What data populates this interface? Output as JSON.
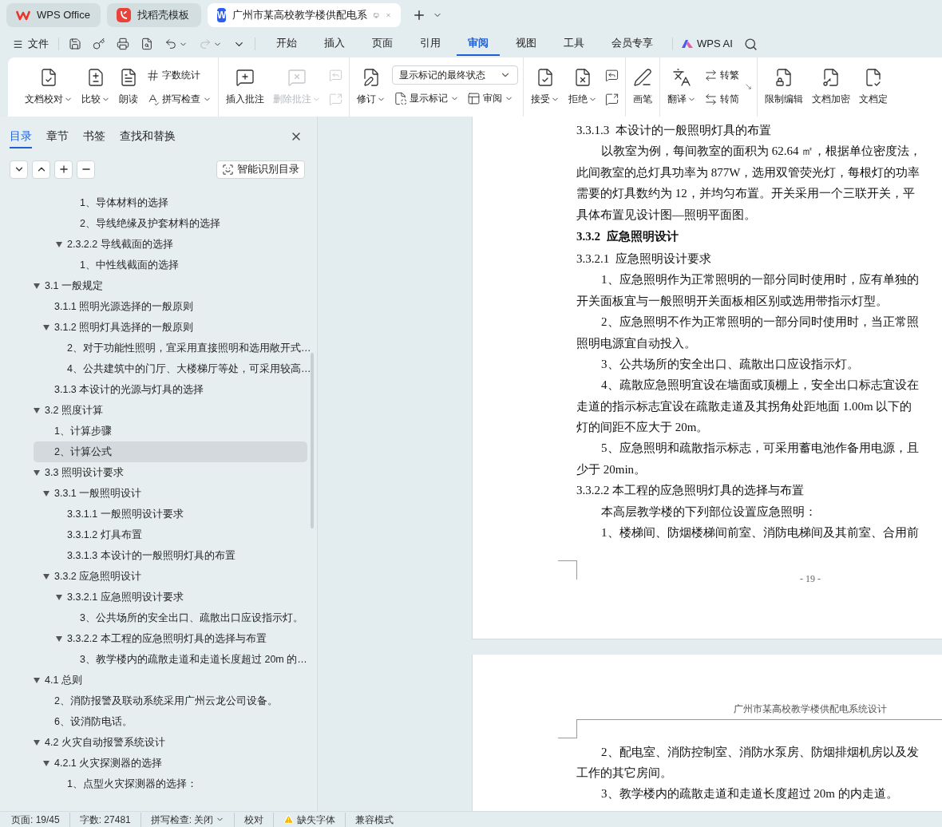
{
  "browser_tabs": [
    {
      "kind": "wps",
      "label": "WPS Office",
      "selected": false
    },
    {
      "kind": "template",
      "label": "找稻壳模板",
      "selected": false
    },
    {
      "kind": "doc",
      "logo_letter": "W",
      "label": "广州市某高校教学楼供配电系",
      "selected": true
    }
  ],
  "menu": {
    "file": "文件",
    "tabs": [
      {
        "label": "开始",
        "selected": false
      },
      {
        "label": "插入",
        "selected": false
      },
      {
        "label": "页面",
        "selected": false
      },
      {
        "label": "引用",
        "selected": false
      },
      {
        "label": "审阅",
        "selected": true
      },
      {
        "label": "视图",
        "selected": false
      },
      {
        "label": "工具",
        "selected": false
      },
      {
        "label": "会员专享",
        "selected": false
      }
    ],
    "ai": "WPS AI",
    "redo_disabled": true
  },
  "ribbon": {
    "groups": [
      {
        "items": [
          {
            "kind": "large",
            "label": "文档校对",
            "dropdown": true,
            "disabled": false
          },
          {
            "kind": "large",
            "label": "比较",
            "dropdown": true,
            "disabled": false
          },
          {
            "kind": "large",
            "label": "朗读",
            "dropdown": false,
            "disabled": false
          },
          {
            "kind": "stack",
            "items": [
              {
                "label": "字数统计",
                "dropdown": false,
                "disabled": false
              },
              {
                "label": "拼写检查",
                "dropdown": true,
                "disabled": false
              }
            ]
          }
        ]
      },
      {
        "items": [
          {
            "kind": "large",
            "label": "插入批注",
            "dropdown": false,
            "disabled": false
          },
          {
            "kind": "large",
            "label": "删除批注",
            "dropdown": true,
            "disabled": true
          },
          {
            "kind": "stack",
            "items": [
              {
                "dropdown": false,
                "disabled": true
              },
              {
                "dropdown": false,
                "disabled": true
              }
            ]
          }
        ]
      },
      {
        "items": [
          {
            "kind": "large",
            "label": "修订",
            "dropdown": true,
            "disabled": false
          },
          {
            "kind": "select",
            "value": "显示标记的最终状态",
            "items": [
              {
                "label": "显示标记",
                "dropdown": true,
                "disabled": false
              },
              {
                "label": "审阅",
                "dropdown": true,
                "disabled": false
              }
            ]
          }
        ]
      },
      {
        "items": [
          {
            "kind": "large",
            "label": "接受",
            "dropdown": true,
            "disabled": false
          },
          {
            "kind": "large",
            "label": "拒绝",
            "dropdown": true,
            "disabled": false
          },
          {
            "kind": "stack",
            "items": [
              {
                "dropdown": false,
                "disabled": false
              },
              {
                "dropdown": false,
                "disabled": false
              }
            ]
          }
        ]
      },
      {
        "items": [
          {
            "kind": "large",
            "label": "画笔",
            "dropdown": false,
            "disabled": false
          }
        ]
      },
      {
        "items": [
          {
            "kind": "large",
            "label": "翻译",
            "dropdown": true,
            "disabled": false
          },
          {
            "kind": "stack",
            "items": [
              {
                "label": "转繁",
                "dropdown": false,
                "disabled": false
              },
              {
                "label": "转简",
                "dropdown": false,
                "disabled": false
              }
            ]
          },
          {
            "kind": "launcher"
          }
        ]
      },
      {
        "items": [
          {
            "kind": "large",
            "label": "限制编辑",
            "dropdown": false,
            "disabled": false
          },
          {
            "kind": "large",
            "label": "文档加密",
            "dropdown": false,
            "disabled": false
          },
          {
            "kind": "large",
            "label": "文档定",
            "dropdown": false,
            "disabled": false
          }
        ]
      }
    ]
  },
  "sidebar": {
    "tabs": [
      {
        "label": "目录",
        "selected": true
      },
      {
        "label": "章节",
        "selected": false
      },
      {
        "label": "书签",
        "selected": false
      },
      {
        "label": "查找和替换",
        "selected": false
      }
    ],
    "smart_button": "智能识别目录",
    "toc": [
      {
        "kind": "offscreen",
        "children": [
          {
            "kind": "offscreen",
            "children": [
              {
                "kind": "offscreen",
                "children": [
                  {
                    "kind": "item",
                    "label": "1、导体材料的选择",
                    "selected": false
                  },
                  {
                    "kind": "item",
                    "label": "2、导线绝缘及护套材料的选择",
                    "selected": false
                  }
                ]
              },
              {
                "kind": "item",
                "label": "2.3.2.2 导线截面的选择",
                "selected": false,
                "expanded": true,
                "children": [
                  {
                    "kind": "item",
                    "label": "1、中性线截面的选择",
                    "selected": false
                  }
                ]
              }
            ]
          }
        ]
      },
      {
        "kind": "item",
        "label": "3.1  一般规定",
        "selected": false,
        "expanded": true,
        "children": [
          {
            "kind": "item",
            "label": "3.1.1  照明光源选择的一般原则",
            "selected": false
          },
          {
            "kind": "item",
            "label": "3.1.2  照明灯具选择的一般原则",
            "selected": false,
            "expanded": true,
            "children": [
              {
                "kind": "item",
                "label": "2、对于功能性照明，宜采用直接照明和选用敞开式…",
                "selected": false
              },
              {
                "kind": "item",
                "label": "4、公共建筑中的门厅、大楼梯厅等处，可采用较高…",
                "selected": false
              }
            ]
          },
          {
            "kind": "item",
            "label": "3.1.3  本设计的光源与灯具的选择",
            "selected": false
          }
        ]
      },
      {
        "kind": "item",
        "label": "3.2 照度计算",
        "selected": false,
        "expanded": true,
        "children": [
          {
            "kind": "item",
            "label": "1、计算步骤",
            "selected": false
          },
          {
            "kind": "item",
            "label": "2、计算公式",
            "selected": true
          }
        ]
      },
      {
        "kind": "item",
        "label": "3.3  照明设计要求",
        "selected": false,
        "expanded": true,
        "children": [
          {
            "kind": "item",
            "label": "3.3.1  一般照明设计",
            "selected": false,
            "expanded": true,
            "children": [
              {
                "kind": "item",
                "label": "3.3.1.1  一般照明设计要求",
                "selected": false
              },
              {
                "kind": "item",
                "label": "3.3.1.2  灯具布置",
                "selected": false
              },
              {
                "kind": "item",
                "label": "3.3.1.3  本设计的一般照明灯具的布置",
                "selected": false
              }
            ]
          },
          {
            "kind": "item",
            "label": "3.3.2  应急照明设计",
            "selected": false,
            "expanded": true,
            "children": [
              {
                "kind": "item",
                "label": "3.3.2.1  应急照明设计要求",
                "selected": false,
                "expanded": true,
                "children": [
                  {
                    "kind": "item",
                    "label": "3、公共场所的安全出口、疏散出口应设指示灯。",
                    "selected": false
                  }
                ]
              },
              {
                "kind": "item",
                "label": "3.3.2.2 本工程的应急照明灯具的选择与布置",
                "selected": false,
                "expanded": true,
                "children": [
                  {
                    "kind": "item",
                    "label": "3、教学楼内的疏散走道和走道长度超过 20m 的…",
                    "selected": false
                  }
                ]
              }
            ]
          }
        ]
      },
      {
        "kind": "item",
        "label": "4.1  总则",
        "selected": false,
        "expanded": true,
        "children": [
          {
            "kind": "item",
            "label": "2、消防报警及联动系统采用广州云龙公司设备。",
            "selected": false
          },
          {
            "kind": "item",
            "label": "6、设消防电话。",
            "selected": false
          }
        ]
      },
      {
        "kind": "item",
        "label": "4.2  火灾自动报警系统设计",
        "selected": false,
        "expanded": true,
        "children": [
          {
            "kind": "item",
            "label": "4.2.1  火灾探测器的选择",
            "selected": false,
            "expanded": true,
            "children": [
              {
                "kind": "item",
                "label": "1、点型火灾探测器的选择：",
                "selected": false
              }
            ]
          }
        ]
      }
    ]
  },
  "document": {
    "pages": [
      {
        "lines": [
          {
            "kind": "heading",
            "text": "3.3.1.3  本设计的一般照明灯具的布置"
          },
          {
            "kind": "indent",
            "text": "以教室为例，每间教室的面积为 62.64 ㎡，根据单位密度法，"
          },
          {
            "kind": "line",
            "text": "此间教室的总灯具功率为 877W，选用双管荧光灯，每根灯的功率"
          },
          {
            "kind": "line",
            "text": "需要的灯具数约为 12，并均匀布置。开关采用一个三联开关，平"
          },
          {
            "kind": "line",
            "text": "具体布置见设计图—照明平面图。"
          },
          {
            "kind": "bold",
            "text": "3.3.2  应急照明设计"
          },
          {
            "kind": "heading",
            "text": "3.3.2.1  应急照明设计要求"
          },
          {
            "kind": "indent",
            "text": "1、应急照明作为正常照明的一部分同时使用时，应有单独的"
          },
          {
            "kind": "line",
            "text": "开关面板宜与一般照明开关面板相区别或选用带指示灯型。"
          },
          {
            "kind": "indent",
            "text": "2、应急照明不作为正常照明的一部分同时使用时，当正常照"
          },
          {
            "kind": "line",
            "text": "照明电源宜自动投入。"
          },
          {
            "kind": "indent",
            "text": "3、公共场所的安全出口、疏散出口应设指示灯。"
          },
          {
            "kind": "indent",
            "text": "4、疏散应急照明宜设在墙面或顶棚上，安全出口标志宜设在"
          },
          {
            "kind": "line",
            "text": "走道的指示标志宜设在疏散走道及其拐角处距地面 1.00m 以下的"
          },
          {
            "kind": "line",
            "text": "灯的间距不应大于 20m。"
          },
          {
            "kind": "indent",
            "text": "5、应急照明和疏散指示标志，可采用蓄电池作备用电源，且"
          },
          {
            "kind": "line",
            "text": "少于 20min。"
          },
          {
            "kind": "heading",
            "text": "3.3.2.2 本工程的应急照明灯具的选择与布置"
          },
          {
            "kind": "indent",
            "text": "本高层教学楼的下列部位设置应急照明："
          },
          {
            "kind": "indent",
            "text": "1、楼梯间、防烟楼梯间前室、消防电梯间及其前室、合用前"
          }
        ],
        "footer": "- 19 -"
      },
      {
        "header": "广州市某高校教学楼供配电系统设计",
        "lines": [
          {
            "kind": "indent",
            "text": "2、配电室、消防控制室、消防水泵房、防烟排烟机房以及发"
          },
          {
            "kind": "line",
            "text": "工作的其它房间。"
          },
          {
            "kind": "indent",
            "text": "3、教学楼内的疏散走道和走道长度超过 20m 的内走道。"
          }
        ]
      }
    ]
  },
  "status_bar": [
    {
      "kind": "text",
      "label": "页面: 19/45"
    },
    {
      "kind": "text",
      "label": "字数: 27481"
    },
    {
      "kind": "dropdown",
      "label": "拼写检查: 关闭"
    },
    {
      "kind": "text",
      "label": "校对"
    },
    {
      "kind": "warning",
      "label": "缺失字体"
    },
    {
      "kind": "text",
      "label": "兼容模式"
    }
  ]
}
